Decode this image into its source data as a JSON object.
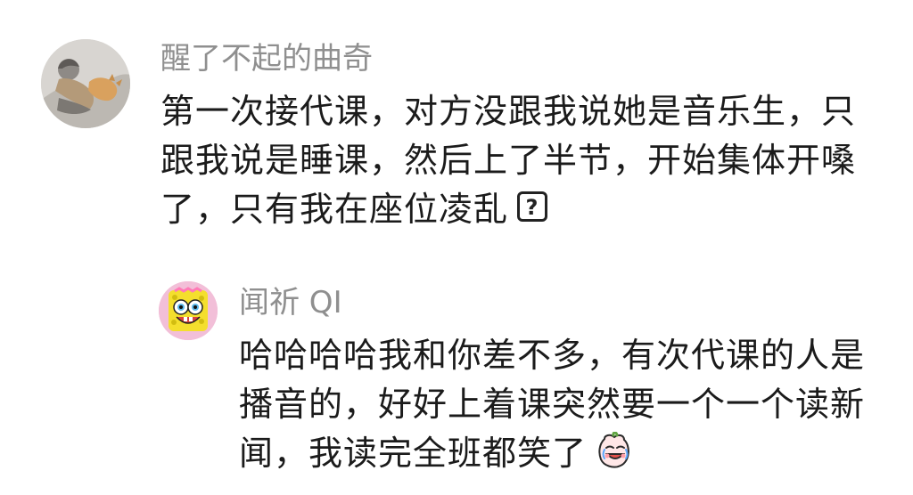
{
  "comments": [
    {
      "username": "醒了不起的曲奇",
      "avatar_icon": "person-lying-with-cat-avatar",
      "lines": [
        "第一次接代课，对方没跟我说她是音乐生，只",
        "跟我说是睡课，然后上了半节，开始集体开嗓",
        "了，只有我在座位凌乱"
      ],
      "emoji": {
        "icon": "question-mark-icon",
        "glyph": "?"
      }
    },
    {
      "username": "闻祈 QI",
      "avatar_icon": "sponge-cartoon-avatar",
      "lines": [
        "哈哈哈哈我和你差不多，有次代课的人是",
        "播音的，好好上着课突然要一个一个读新",
        "闻，我读完全班都笑了"
      ],
      "emoji": {
        "icon": "crying-laughing-emoji-icon"
      }
    }
  ],
  "colors": {
    "username": "#8f8f8f",
    "text": "#1b1b1b",
    "background": "#ffffff"
  }
}
